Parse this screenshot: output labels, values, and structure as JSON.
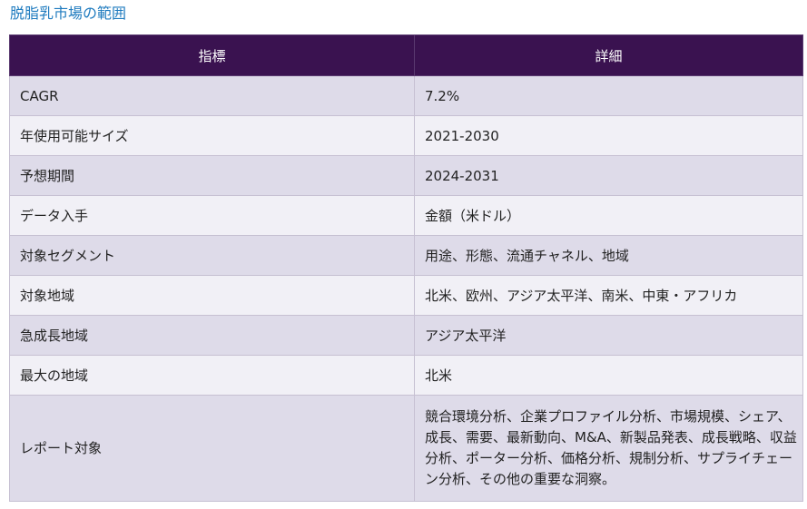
{
  "page": {
    "title": "脱脂乳市場の範囲"
  },
  "table": {
    "headers": [
      "指標",
      "詳細"
    ],
    "rows": [
      {
        "metric": "CAGR",
        "detail": "7.2%"
      },
      {
        "metric": "年使用可能サイズ",
        "detail": "2021-2030"
      },
      {
        "metric": "予想期間",
        "detail": "2024-2031"
      },
      {
        "metric": "データ入手",
        "detail": "金額（米ドル）"
      },
      {
        "metric": "対象セグメント",
        "detail": "用途、形態、流通チャネル、地域"
      },
      {
        "metric": "対象地域",
        "detail": "北米、欧州、アジア太平洋、南米、中東・アフリカ"
      },
      {
        "metric": "急成長地域",
        "detail": "アジア太平洋"
      },
      {
        "metric": "最大の地域",
        "detail": "北米"
      },
      {
        "metric": "レポート対象",
        "detail": "競合環境分析、企業プロファイル分析、市場規模、シェア、成長、需要、最新動向、M&A、新製品発表、成長戦略、収益分析、ポーター分析、価格分析、規制分析、サプライチェーン分析、その他の重要な洞察。"
      }
    ]
  },
  "colors": {
    "title": "#1f7bbf",
    "header_bg": "#3a1250",
    "header_text": "#ffffff",
    "row_alt_a": "#dedbe9",
    "row_alt_b": "#f1f0f6",
    "border": "#c6c0d2"
  }
}
